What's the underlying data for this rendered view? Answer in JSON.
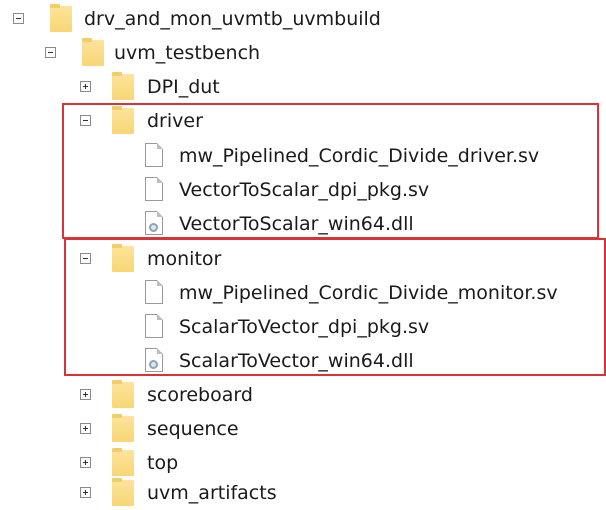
{
  "colors": {
    "folder": "#f8d675",
    "highlight_border": "#d9323b",
    "text": "#1a1a1a"
  },
  "tree": {
    "root": {
      "label": "drv_and_mon_uvmtb_uvmbuild",
      "expander": "minus",
      "icon": "folder-icon"
    },
    "uvm_testbench": {
      "label": "uvm_testbench",
      "expander": "minus",
      "icon": "folder-icon"
    },
    "dpi_dut": {
      "label": "DPI_dut",
      "expander": "plus",
      "icon": "folder-icon"
    },
    "driver": {
      "label": "driver",
      "expander": "minus",
      "icon": "folder-icon",
      "files": [
        {
          "label": "mw_Pipelined_Cordic_Divide_driver.sv",
          "icon": "sv-file-icon"
        },
        {
          "label": "VectorToScalar_dpi_pkg.sv",
          "icon": "sv-file-icon"
        },
        {
          "label": "VectorToScalar_win64.dll",
          "icon": "dll-file-icon"
        }
      ]
    },
    "monitor": {
      "label": "monitor",
      "expander": "minus",
      "icon": "folder-icon",
      "files": [
        {
          "label": "mw_Pipelined_Cordic_Divide_monitor.sv",
          "icon": "sv-file-icon"
        },
        {
          "label": "ScalarToVector_dpi_pkg.sv",
          "icon": "sv-file-icon"
        },
        {
          "label": "ScalarToVector_win64.dll",
          "icon": "dll-file-icon"
        }
      ]
    },
    "scoreboard": {
      "label": "scoreboard",
      "expander": "plus",
      "icon": "folder-icon"
    },
    "sequence": {
      "label": "sequence",
      "expander": "plus",
      "icon": "folder-icon"
    },
    "top": {
      "label": "top",
      "expander": "plus",
      "icon": "folder-icon"
    },
    "uvm_artifacts": {
      "label": "uvm_artifacts",
      "expander": "plus",
      "icon": "folder-icon"
    }
  }
}
